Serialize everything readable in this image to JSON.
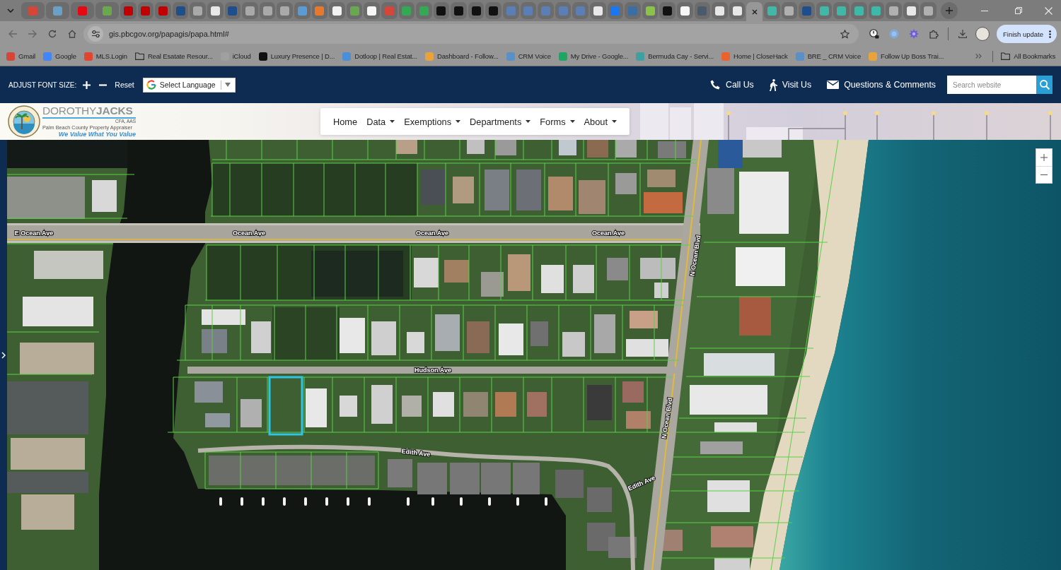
{
  "browser": {
    "tabs": [
      {
        "pinned": true,
        "selected": false,
        "color": "#d44638"
      },
      {
        "pinned": true,
        "selected": false,
        "color": "#6aa0c8"
      },
      {
        "pinned": true,
        "selected": false,
        "color": "#e50914"
      },
      {
        "pinned": true,
        "selected": false,
        "color": "#6aa84f"
      },
      {
        "pinned": false,
        "selected": false,
        "color": "#c00000"
      },
      {
        "pinned": false,
        "selected": false,
        "color": "#c00000"
      },
      {
        "pinned": false,
        "selected": false,
        "color": "#c00000"
      },
      {
        "pinned": false,
        "selected": false,
        "color": "#1f4e8c"
      },
      {
        "pinned": false,
        "selected": false,
        "color": "#a9a9a9"
      },
      {
        "pinned": false,
        "selected": false,
        "color": "#e8e8e8"
      },
      {
        "pinned": false,
        "selected": false,
        "color": "#1f4e8c"
      },
      {
        "pinned": false,
        "selected": false,
        "color": "#a9a9a9"
      },
      {
        "pinned": false,
        "selected": false,
        "color": "#a9a9a9"
      },
      {
        "pinned": false,
        "selected": false,
        "color": "#a9a9a9"
      },
      {
        "pinned": false,
        "selected": false,
        "color": "#5b9bd5"
      },
      {
        "pinned": false,
        "selected": false,
        "color": "#e8782b"
      },
      {
        "pinned": false,
        "selected": false,
        "color": "#f2f2f2"
      },
      {
        "pinned": false,
        "selected": false,
        "color": "#6aa84f"
      },
      {
        "pinned": false,
        "selected": false,
        "color": "#f7f7f7"
      },
      {
        "pinned": false,
        "selected": false,
        "color": "#d44638"
      },
      {
        "pinned": false,
        "selected": false,
        "color": "#34a853"
      },
      {
        "pinned": false,
        "selected": false,
        "color": "#34a853"
      },
      {
        "pinned": false,
        "selected": false,
        "color": "#111111"
      },
      {
        "pinned": false,
        "selected": false,
        "color": "#111111"
      },
      {
        "pinned": false,
        "selected": false,
        "color": "#111111"
      },
      {
        "pinned": false,
        "selected": false,
        "color": "#111111"
      },
      {
        "pinned": false,
        "selected": false,
        "color": "#5b7fb5"
      },
      {
        "pinned": false,
        "selected": false,
        "color": "#5b7fb5"
      },
      {
        "pinned": false,
        "selected": false,
        "color": "#5b7fb5"
      },
      {
        "pinned": false,
        "selected": false,
        "color": "#5b7fb5"
      },
      {
        "pinned": false,
        "selected": false,
        "color": "#5b7fb5"
      },
      {
        "pinned": false,
        "selected": false,
        "color": "#e8e8e8"
      },
      {
        "pinned": false,
        "selected": false,
        "color": "#1877f2"
      },
      {
        "pinned": false,
        "selected": false,
        "color": "#3a6ea5"
      },
      {
        "pinned": false,
        "selected": false,
        "color": "#8bc34a"
      },
      {
        "pinned": false,
        "selected": false,
        "color": "#111111"
      },
      {
        "pinned": false,
        "selected": false,
        "color": "#f7f7f7"
      },
      {
        "pinned": false,
        "selected": false,
        "color": "#4a5a6a"
      },
      {
        "pinned": false,
        "selected": false,
        "color": "#e8e8e8"
      },
      {
        "pinned": false,
        "selected": false,
        "color": "#e8e8e8"
      },
      {
        "pinned": false,
        "selected": true
      },
      {
        "pinned": false,
        "selected": false,
        "color": "#3fb8a8"
      },
      {
        "pinned": false,
        "selected": false,
        "color": "#b0b0b0"
      },
      {
        "pinned": false,
        "selected": false,
        "color": "#1f4e8c"
      },
      {
        "pinned": false,
        "selected": false,
        "color": "#3fb8a8"
      },
      {
        "pinned": false,
        "selected": false,
        "color": "#3fb8a8"
      },
      {
        "pinned": false,
        "selected": false,
        "color": "#3fb8a8"
      },
      {
        "pinned": false,
        "selected": false,
        "color": "#3fb8a8"
      },
      {
        "pinned": false,
        "selected": false,
        "color": "#b0b0b0"
      },
      {
        "pinned": false,
        "selected": false,
        "color": "#e8e8e8"
      },
      {
        "pinned": false,
        "selected": false,
        "color": "#b0b0b0"
      }
    ],
    "address_bar": {
      "url": "gis.pbcgov.org/papagis/papa.html#"
    },
    "update_button": {
      "label": "Finish update"
    },
    "bookmarks": [
      {
        "label": "Gmail",
        "kind": "site",
        "color": "#d44638"
      },
      {
        "label": "Google",
        "kind": "site",
        "color": "#4285f4"
      },
      {
        "label": "MLS.Login",
        "kind": "site",
        "color": "#e0462f"
      },
      {
        "label": "Real Esatate Resour...",
        "kind": "folder"
      },
      {
        "label": "iCloud",
        "kind": "site",
        "color": "#a0a0a0"
      },
      {
        "label": "Luxury Presence | D...",
        "kind": "site",
        "color": "#111111"
      },
      {
        "label": "Dotloop | Real Estat...",
        "kind": "site",
        "color": "#4a90d9"
      },
      {
        "label": "Dashboard - Follow...",
        "kind": "site",
        "color": "#e8a33c"
      },
      {
        "label": "CRM Voice",
        "kind": "site",
        "color": "#5b8fc8"
      },
      {
        "label": "My Drive - Google...",
        "kind": "site",
        "color": "#1fa463"
      },
      {
        "label": "Bermuda Cay - Servi...",
        "kind": "site",
        "color": "#3fa0a0"
      },
      {
        "label": "Home | CloseHack",
        "kind": "site",
        "color": "#e8642c"
      },
      {
        "label": "BRE _ CRM Voice",
        "kind": "site",
        "color": "#5b8fc8"
      },
      {
        "label": "Follow Up Boss Trai...",
        "kind": "site",
        "color": "#e8a33c"
      }
    ],
    "all_bookmarks": {
      "label": "All Bookmarks"
    }
  },
  "site_header": {
    "font_size_label": "ADJUST FONT SIZE:",
    "reset": "Reset",
    "language": "Select Language",
    "links": [
      {
        "label": "Call Us",
        "kind": "phone"
      },
      {
        "label": "Visit Us",
        "kind": "walk"
      },
      {
        "label": "Questions & Comments",
        "kind": "mail"
      }
    ],
    "search": {
      "placeholder": "Search website"
    }
  },
  "logo": {
    "name": "DOROTHY**JACKS**",
    "credentials": "CFA, AAS",
    "office": "Palm Beach County Property Appraiser",
    "slogan": "We Value What You Value"
  },
  "nav": [
    {
      "label": "Home",
      "dropdown": false
    },
    {
      "label": "Data",
      "dropdown": true
    },
    {
      "label": "Exemptions",
      "dropdown": true
    },
    {
      "label": "Departments",
      "dropdown": true
    },
    {
      "label": "Forms",
      "dropdown": true
    },
    {
      "label": "About",
      "dropdown": true
    }
  ],
  "map": {
    "street_labels": [
      "E Ocean Ave",
      "Ocean Ave",
      "Ocean Ave",
      "Ocean Ave",
      "N Ocean Blvd",
      "Hudson Ave",
      "N Ocean Blvd",
      "Edith Ave",
      "Edith Ave"
    ],
    "parcel_selected": true
  }
}
